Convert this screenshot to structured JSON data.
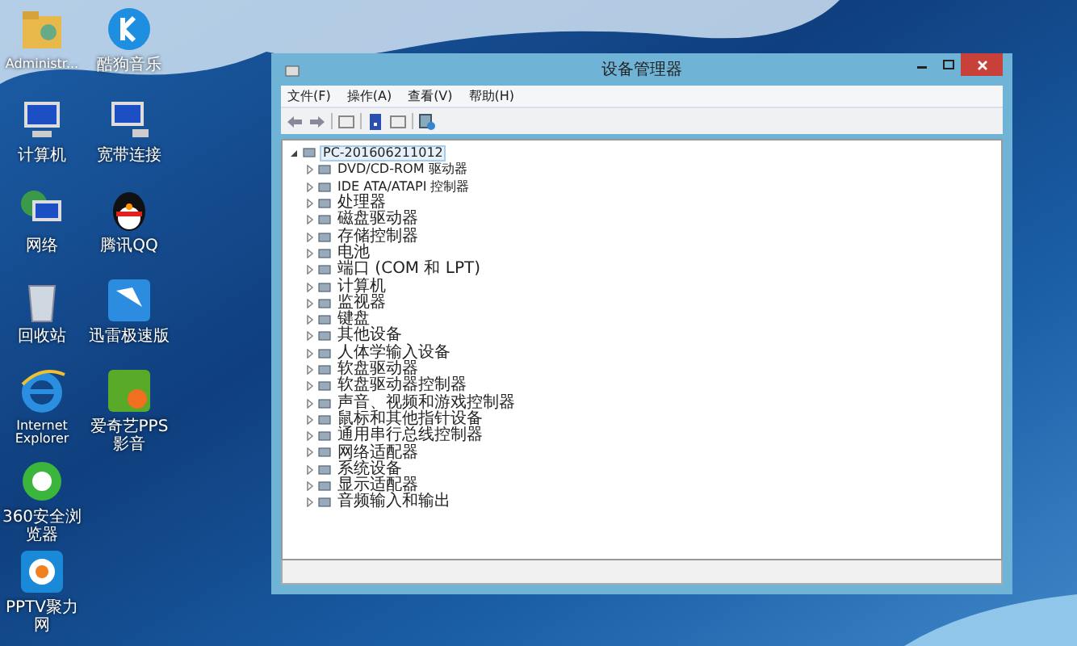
{
  "desktop_icons": [
    {
      "kind": "folder",
      "label": "Administr..."
    },
    {
      "kind": "computer",
      "label": "计算机"
    },
    {
      "kind": "network",
      "label": "网络"
    },
    {
      "kind": "recycle",
      "label": "回收站"
    },
    {
      "kind": "ie",
      "label": "Internet Explorer"
    },
    {
      "kind": "browser360",
      "label": "360安全浏览器"
    },
    {
      "kind": "pptv",
      "label": "PPTV聚力网"
    },
    {
      "kind": "music",
      "label": "酷狗音乐"
    },
    {
      "kind": "connection",
      "label": "宽带连接"
    },
    {
      "kind": "qq",
      "label": "腾讯QQ"
    },
    {
      "kind": "bird",
      "label": "迅雷极速版"
    },
    {
      "kind": "video",
      "label": "爱奇艺PPS影音"
    }
  ],
  "window": {
    "title": "设备管理器",
    "menu": [
      "文件(F)",
      "操作(A)",
      "查看(V)",
      "帮助(H)"
    ],
    "tree": {
      "label": "PC-201606211012",
      "expanded": true,
      "selected": true,
      "children": [
        {
          "label": "DVD/CD-ROM 驱动器",
          "expanded": false,
          "selected": false
        },
        {
          "label": "IDE ATA/ATAPI 控制器",
          "expanded": false,
          "selected": false
        },
        {
          "label": "处理器",
          "expanded": false,
          "selected": false
        },
        {
          "label": "磁盘驱动器",
          "expanded": false,
          "selected": false
        },
        {
          "label": "存储控制器",
          "expanded": false,
          "selected": false
        },
        {
          "label": "电池",
          "expanded": false,
          "selected": false
        },
        {
          "label": "端口 (COM 和 LPT)",
          "expanded": false,
          "selected": false
        },
        {
          "label": "计算机",
          "expanded": false,
          "selected": false
        },
        {
          "label": "监视器",
          "expanded": false,
          "selected": false
        },
        {
          "label": "键盘",
          "expanded": false,
          "selected": false
        },
        {
          "label": "其他设备",
          "expanded": false,
          "selected": false
        },
        {
          "label": "人体学输入设备",
          "expanded": false,
          "selected": false
        },
        {
          "label": "软盘驱动器",
          "expanded": false,
          "selected": false
        },
        {
          "label": "软盘驱动器控制器",
          "expanded": false,
          "selected": false
        },
        {
          "label": "声音、视频和游戏控制器",
          "expanded": false,
          "selected": false
        },
        {
          "label": "鼠标和其他指针设备",
          "expanded": false,
          "selected": false
        },
        {
          "label": "通用串行总线控制器",
          "expanded": false,
          "selected": false
        },
        {
          "label": "网络适配器",
          "expanded": false,
          "selected": false
        },
        {
          "label": "系统设备",
          "expanded": false,
          "selected": false
        },
        {
          "label": "显示适配器",
          "expanded": false,
          "selected": false
        },
        {
          "label": "音频输入和输出",
          "expanded": false,
          "selected": false
        }
      ]
    }
  }
}
